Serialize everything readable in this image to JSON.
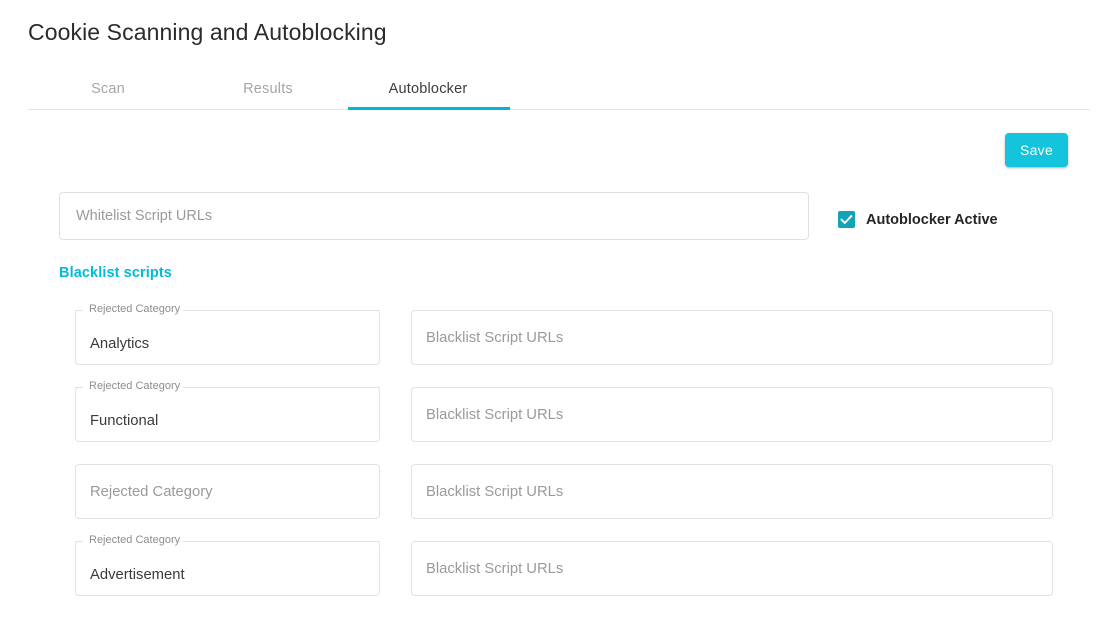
{
  "page": {
    "title": "Cookie Scanning and Autoblocking"
  },
  "tabs": [
    {
      "label": "Scan",
      "active": false
    },
    {
      "label": "Results",
      "active": false
    },
    {
      "label": "Autoblocker",
      "active": true
    }
  ],
  "toolbar": {
    "save_label": "Save"
  },
  "whitelist": {
    "placeholder": "Whitelist Script URLs",
    "value": ""
  },
  "autoblocker_toggle": {
    "label": "Autoblocker Active",
    "checked": true,
    "icon": "check-icon"
  },
  "blacklist": {
    "heading": "Blacklist scripts",
    "category_label": "Rejected Category",
    "category_placeholder": "Rejected Category",
    "urls_placeholder": "Blacklist Script URLs",
    "rows": [
      {
        "category": "Analytics",
        "urls": ""
      },
      {
        "category": "Functional",
        "urls": ""
      },
      {
        "category": "",
        "urls": ""
      },
      {
        "category": "Advertisement",
        "urls": ""
      }
    ]
  },
  "colors": {
    "accent": "#00bcd8",
    "save_button": "#14c4dc",
    "checkbox": "#12a3b4",
    "tab_indicator": "#00b8d4",
    "border": "#e2e2e2",
    "title_text": "#2b2b2b",
    "muted_text": "#9a9a9a"
  }
}
